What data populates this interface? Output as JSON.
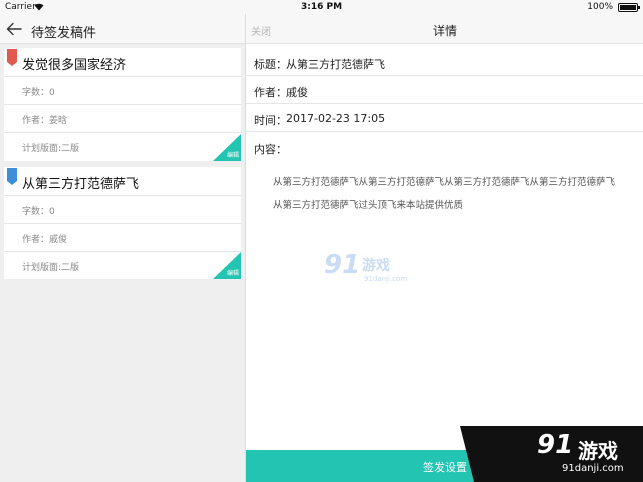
{
  "status_bar": {
    "carrier": "Carrier",
    "time": "3:16 PM",
    "battery": "100%"
  },
  "left_panel": {
    "title": "待签发稿件",
    "manuscripts": [
      {
        "tag_color": "#e05a4e",
        "title": "发觉很多国家经济",
        "word_count": "字数：0",
        "author": "作者：姜晗",
        "plan": "计划版面:二版",
        "edit_label": "编辑"
      },
      {
        "tag_color": "#3d8fd8",
        "title": "从第三方打范德萨飞",
        "word_count": "字数：0",
        "author": "作者：戚俊",
        "plan": "计划版面:二版",
        "edit_label": "编辑"
      }
    ]
  },
  "detail_panel": {
    "close_label": "关闭",
    "title": "详情",
    "fields": {
      "title_label": "标题：",
      "title_value": "从第三方打范德萨飞",
      "author_label": "作者：",
      "author_value": "戚俊",
      "time_label": "时间：",
      "time_value": "2017-02-23 17:05",
      "content_label": "内容："
    },
    "content_text": "从第三方打范德萨飞从第三方打范德萨飞从第三方打范德萨飞从第三方打范德萨飞从第三方打范德萨飞过头顶飞来本站提供优质",
    "sign_button": "签发设置"
  },
  "watermarks": {
    "logo_number": "91",
    "logo_text": "游戏",
    "logo_url": "91danji.com"
  },
  "colors": {
    "accent": "#23c4b1"
  }
}
